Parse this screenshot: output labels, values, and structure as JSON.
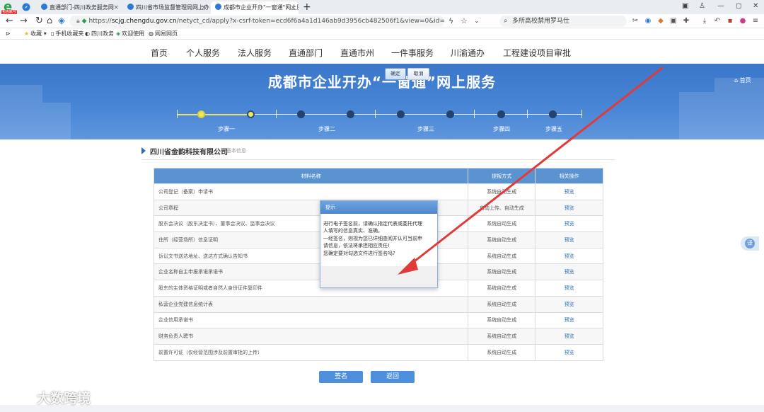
{
  "browser": {
    "logo_badge": "包含账号",
    "tabs": [
      {
        "label": "直通部门-四川政务服务网",
        "active": false
      },
      {
        "label": "四川省市场监督管理局网上办事",
        "active": false
      },
      {
        "label": "成都市企业开办\"一窗通\"网上服",
        "active": true
      }
    ],
    "new_tab": "+",
    "url_host": "scjg.chengdu.gov.cn",
    "url_path": "/netyct_cd/apply?x-csrf-token=ecd6f6a4a1d146ab9d3956cb482506f1&view=0&id=510109Y32025060",
    "search_text": "多所高校禁用罗马仕",
    "bookmarks": [
      "收藏",
      "手机收藏夹",
      "四川政务",
      "欢迎使用",
      "网易网页"
    ]
  },
  "site_nav": [
    "首页",
    "个人服务",
    "法人服务",
    "直通部门",
    "直通市州",
    "一件事服务",
    "川渝通办",
    "工程建设项目审批"
  ],
  "banner": {
    "title": "成都市企业开办“一窗通”网上服务",
    "home": "首页",
    "steps": [
      "步骤一",
      "步骤二",
      "步骤三",
      "步骤四",
      "步骤五"
    ]
  },
  "company": {
    "name": "四川省金韵科技有限公司",
    "sub": "基本信息"
  },
  "table": {
    "headers": [
      "材料名称",
      "提报方式",
      "相关操作"
    ],
    "rows": [
      {
        "name": "公司登记（备案）申请书",
        "method": "系统自动生成",
        "action": "预览"
      },
      {
        "name": "公司章程",
        "method": "自动上传、自动生成",
        "action": "预览"
      },
      {
        "name": "股东会决议（股东决定书）、董事会决议、监事会决议",
        "method": "系统自动生成",
        "action": "预览"
      },
      {
        "name": "住所（经营场所）信息证明",
        "method": "系统自动生成",
        "action": "预览"
      },
      {
        "name": "诉讼文书送达地址、送达方式确认告知书",
        "method": "系统自动生成",
        "action": "预览"
      },
      {
        "name": "企业名称自主申报承诺承诺书",
        "method": "系统自动生成",
        "action": "预览"
      },
      {
        "name": "股东的主体资格证明或者自然人身份证件复印件",
        "method": "系统自动生成",
        "action": "预览"
      },
      {
        "name": "私营企业党建信息统计表",
        "method": "系统自动生成",
        "action": "预览"
      },
      {
        "name": "企业信用承诺书",
        "method": "系统自动生成",
        "action": "预览"
      },
      {
        "name": "财务负责人聘书",
        "method": "系统自动生成",
        "action": "预览"
      },
      {
        "name": "前置许可证（仅经营范围涉及前置审批的上传）",
        "method": "系统自动生成",
        "action": "预览"
      }
    ]
  },
  "buttons": {
    "sign": "签名",
    "back": "返回"
  },
  "dialog": {
    "title": "提示",
    "lines": [
      "进行电子签名前，请确认指定代表或委托代理",
      "人填写的信息真实、准确。",
      "一经签名，则视为您已详细查阅并认可当前申",
      "请信息，依法将承担相应责任!",
      "您确定要对勾选文件进行签名吗?"
    ],
    "ok": "确定",
    "cancel": "取消"
  },
  "side": {
    "translate": "译"
  },
  "watermark": "大数跨境",
  "colors": {
    "banner": "#4a86d6",
    "arrow": "#e03a3a",
    "table_header": "#5b93d1"
  }
}
